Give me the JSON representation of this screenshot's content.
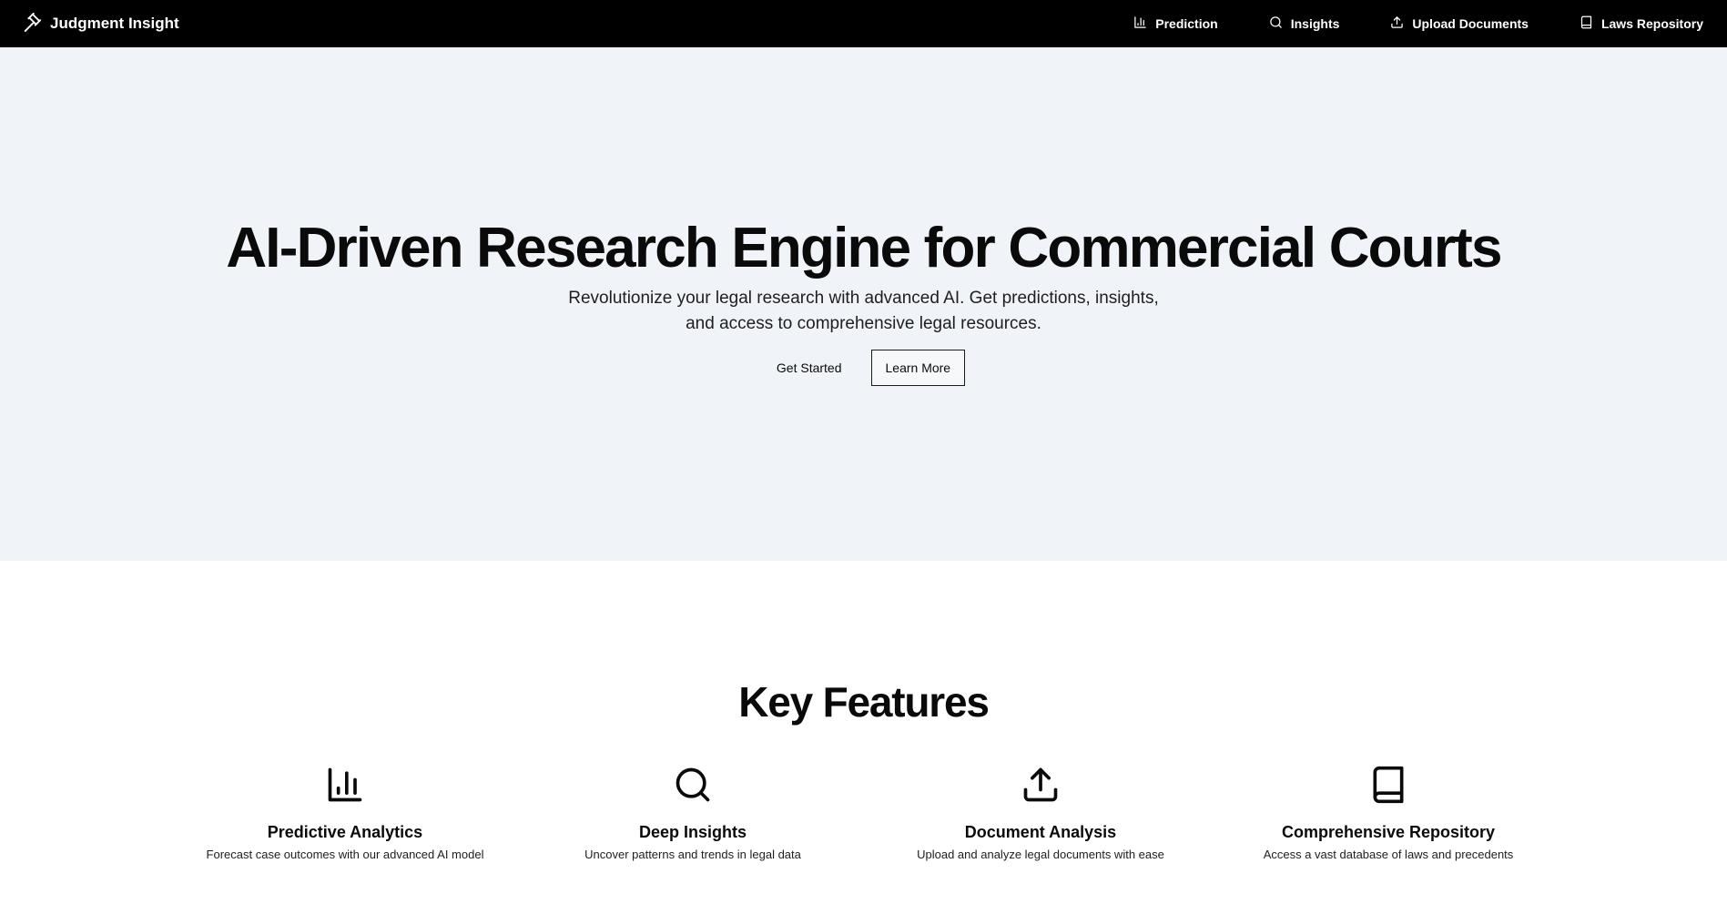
{
  "nav": {
    "brand": "Judgment Insight",
    "brand_icon": "gavel-icon",
    "links": [
      {
        "label": "Prediction",
        "icon": "bar-chart-icon"
      },
      {
        "label": "Insights",
        "icon": "search-icon"
      },
      {
        "label": "Upload Documents",
        "icon": "upload-icon"
      },
      {
        "label": "Laws Repository",
        "icon": "book-icon"
      }
    ]
  },
  "hero": {
    "title": "AI-Driven Research Engine for Commercial Courts",
    "subtitle_line1": "Revolutionize your legal research with advanced AI. Get predictions, insights,",
    "subtitle_line2": "and access to comprehensive legal resources.",
    "primary_button": "Get Started",
    "secondary_button": "Learn More"
  },
  "features": {
    "title": "Key Features",
    "items": [
      {
        "title": "Predictive Analytics",
        "description": "Forecast case outcomes with our advanced AI model",
        "icon": "bar-chart-icon"
      },
      {
        "title": "Deep Insights",
        "description": "Uncover patterns and trends in legal data",
        "icon": "search-icon"
      },
      {
        "title": "Document Analysis",
        "description": "Upload and analyze legal documents with ease",
        "icon": "upload-icon"
      },
      {
        "title": "Comprehensive Repository",
        "description": "Access a vast database of laws and precedents",
        "icon": "book-icon"
      }
    ]
  },
  "colors": {
    "nav_bg": "#000000",
    "hero_bg": "#f0f3f8",
    "text": "#0a0a0a"
  }
}
